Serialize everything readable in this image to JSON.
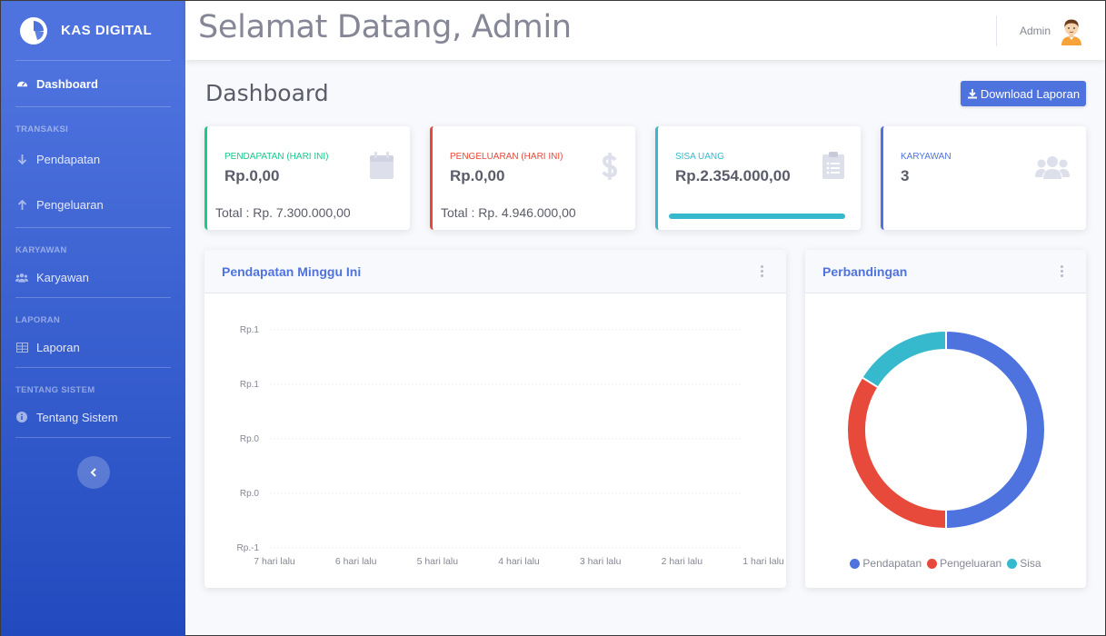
{
  "brand": {
    "name": "KAS DIGITAL"
  },
  "sidebar": {
    "dashboard": "Dashboard",
    "sections": [
      {
        "heading": "TRANSAKSI",
        "items": [
          {
            "label": "Pendapatan",
            "icon": "arrow-down-icon"
          },
          {
            "label": "Pengeluaran",
            "icon": "arrow-up-icon"
          }
        ]
      },
      {
        "heading": "KARYAWAN",
        "items": [
          {
            "label": "Karyawan",
            "icon": "users-icon"
          }
        ]
      },
      {
        "heading": "LAPORAN",
        "items": [
          {
            "label": "Laporan",
            "icon": "table-icon"
          }
        ]
      },
      {
        "heading": "TENTANG SISTEM",
        "items": [
          {
            "label": "Tentang Sistem",
            "icon": "info-icon"
          }
        ]
      }
    ]
  },
  "topbar": {
    "welcome": "Selamat Datang, Admin",
    "user_name": "Admin"
  },
  "page": {
    "title": "Dashboard",
    "download_label": "Download Laporan"
  },
  "stats": [
    {
      "label": "PENDAPATAN (HARI INI)",
      "value": "Rp.0,00",
      "total": "Total : Rp. 7.300.000,00",
      "color": "#1cc88a",
      "icon": "calendar-icon"
    },
    {
      "label": "PENGELUARAN (HARI INI)",
      "value": "Rp.0,00",
      "total": "Total : Rp. 4.946.000,00",
      "color": "#e74a3b",
      "icon": "dollar-icon"
    },
    {
      "label": "SISA UANG",
      "value": "Rp.2.354.000,00",
      "total": "",
      "color": "#36b9cc",
      "icon": "clipboard-icon",
      "progress": 1.0
    },
    {
      "label": "KARYAWAN",
      "value": "3",
      "total": "",
      "color": "#4e73df",
      "icon": "users-icon"
    }
  ],
  "colors": {
    "primary": "#4e73df",
    "success": "#1cc88a",
    "danger": "#e74a3b",
    "info": "#36b9cc"
  },
  "chart_data": [
    {
      "type": "line",
      "title": "Pendapatan Minggu Ini",
      "categories": [
        "7 hari lalu",
        "6 hari lalu",
        "5 hari lalu",
        "4 hari lalu",
        "3 hari lalu",
        "2 hari lalu",
        "1 hari lalu"
      ],
      "y_tick_labels": [
        "Rp.1",
        "Rp.1",
        "Rp.0",
        "Rp.0",
        "Rp.-1"
      ],
      "ylim": [
        -1,
        1
      ],
      "series": [],
      "grid": true
    },
    {
      "type": "pie",
      "title": "Perbandingan",
      "labels": [
        "Pendapatan",
        "Pengeluaran",
        "Sisa"
      ],
      "values": [
        7300000,
        4946000,
        2354000
      ],
      "colors": [
        "#4e73df",
        "#e74a3b",
        "#36b9cc"
      ],
      "legend": "bottom"
    }
  ]
}
